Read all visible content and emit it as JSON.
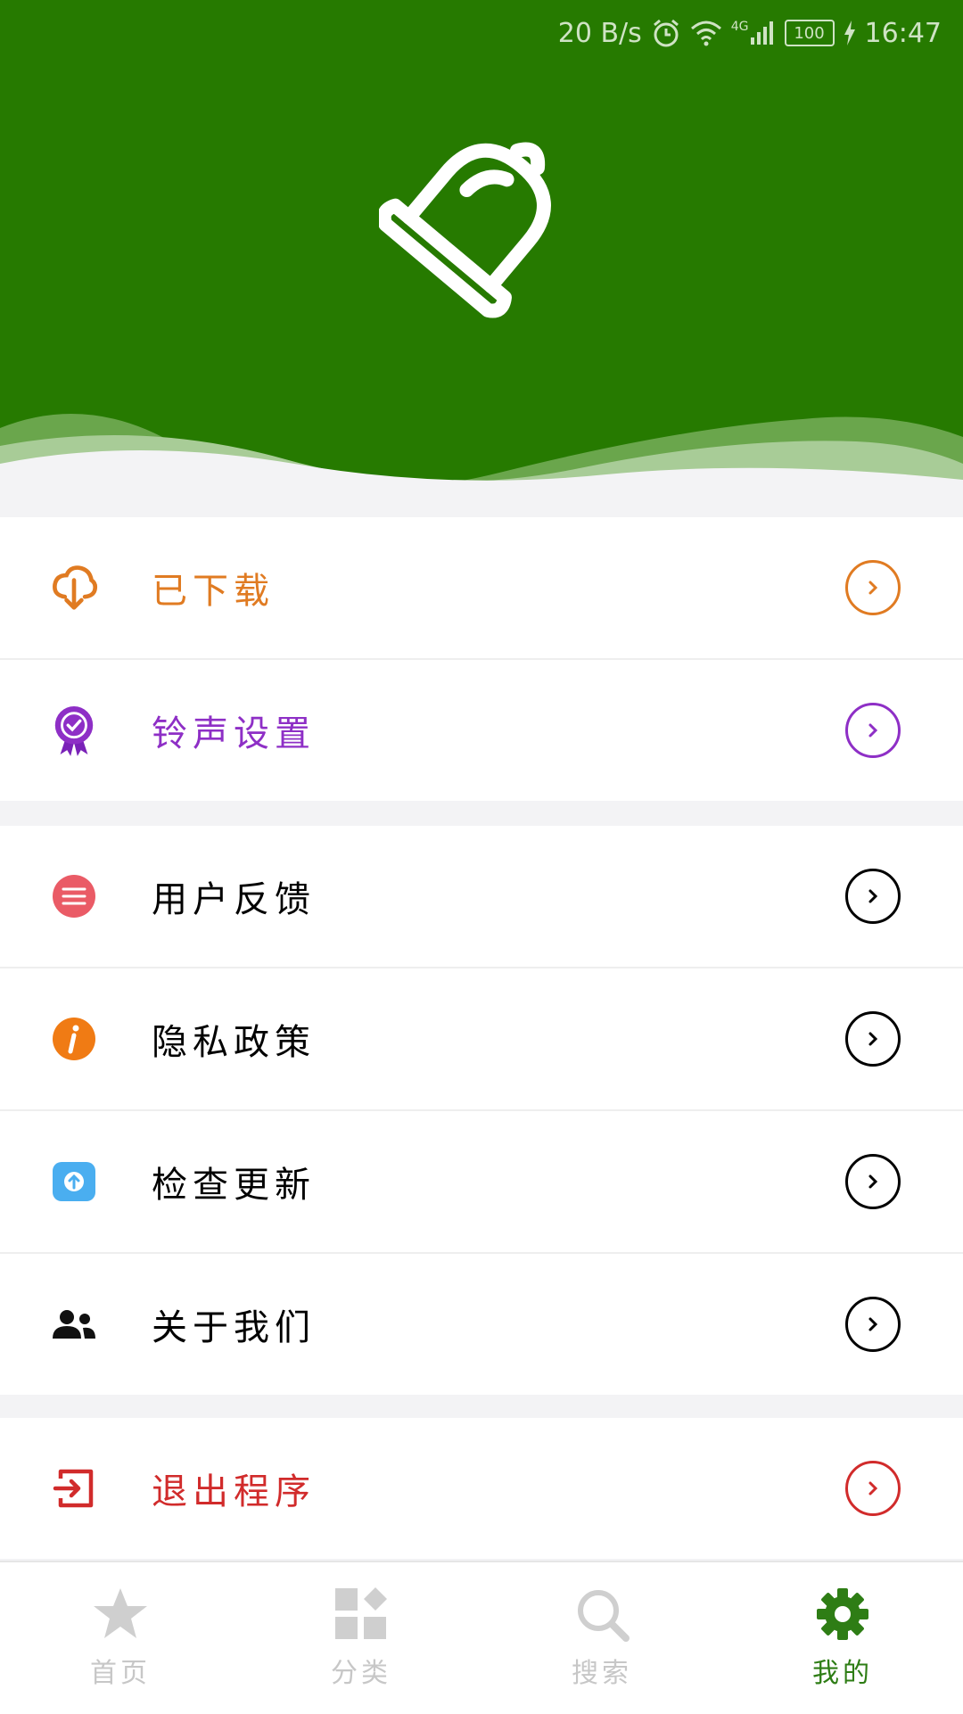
{
  "status_bar": {
    "speed": "20 B/s",
    "network": "4G",
    "battery": "100",
    "time": "16:47"
  },
  "menu_group_1": [
    {
      "label": "已下载",
      "icon": "cloud-download-icon",
      "color": "#e07b22"
    },
    {
      "label": "铃声设置",
      "icon": "badge-check-icon",
      "color": "#8e2fc6"
    }
  ],
  "menu_group_2": [
    {
      "label": "用户反馈",
      "icon": "chat-bubble-icon",
      "color": "#000000"
    },
    {
      "label": "隐私政策",
      "icon": "info-icon",
      "color": "#000000"
    },
    {
      "label": "检查更新",
      "icon": "upload-icon",
      "color": "#000000"
    },
    {
      "label": "关于我们",
      "icon": "people-icon",
      "color": "#000000"
    }
  ],
  "menu_group_3": [
    {
      "label": "退出程序",
      "icon": "exit-icon",
      "color": "#d12b2b"
    }
  ],
  "tabbar": [
    {
      "label": "首页",
      "icon": "star-icon",
      "active": false
    },
    {
      "label": "分类",
      "icon": "grid-icon",
      "active": false
    },
    {
      "label": "搜索",
      "icon": "search-icon",
      "active": false
    },
    {
      "label": "我的",
      "icon": "gear-icon",
      "active": true
    }
  ],
  "colors": {
    "header_green": "#267a00",
    "active_tab": "#2e7d15"
  }
}
